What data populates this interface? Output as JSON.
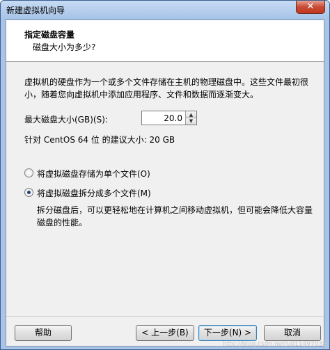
{
  "window": {
    "title": "新建虚拟机向导",
    "close_symbol": "✕"
  },
  "header": {
    "title": "指定磁盘容量",
    "subtitle": "磁盘大小为多少?"
  },
  "description": "虚拟机的硬盘作为一个或多个文件存储在主机的物理磁盘中。这些文件最初很小，随着您向虚拟机中添加应用程序、文件和数据而逐渐变大。",
  "disk_size": {
    "label": "最大磁盘大小(GB)(S):",
    "value": "20.0",
    "up_symbol": "▲",
    "down_symbol": "▼"
  },
  "recommendation": "针对 CentOS 64 位 的建议大小: 20 GB",
  "storage_options": [
    {
      "label": "将虚拟磁盘存储为单个文件(O)",
      "checked": false
    },
    {
      "label": "将虚拟磁盘拆分成多个文件(M)",
      "checked": true
    }
  ],
  "split_note": "拆分磁盘后，可以更轻松地在计算机之间移动虚拟机，但可能会降低大容量磁盘的性能。",
  "buttons": {
    "help": "帮助",
    "back": "< 上一步(B)",
    "next": "下一步(N) >",
    "cancel": "取消"
  },
  "watermark": "http://blog.csdn.net/u011497038"
}
